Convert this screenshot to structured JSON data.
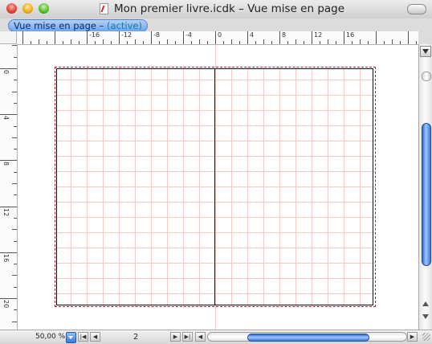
{
  "window": {
    "title": "Mon premier livre.icdk – Vue mise en page"
  },
  "tab": {
    "label": "Vue mise en page – ",
    "state": "(active)"
  },
  "ruler_top": {
    "labels": [
      "-16",
      "-12",
      "-8",
      "-4",
      "0",
      "4",
      "8",
      "12",
      "16"
    ]
  },
  "ruler_left": {
    "labels": [
      "0",
      "4",
      "8",
      "12",
      "16",
      "20"
    ]
  },
  "footer": {
    "zoom": "50,00 %",
    "page_number": "2"
  },
  "icons": {
    "document": "document-icon",
    "zoom_menu": "chevron-down-icon",
    "first_page": "first-page-icon",
    "prev_page": "previous-page-icon",
    "next_page": "next-page-icon",
    "last_page": "last-page-icon"
  }
}
